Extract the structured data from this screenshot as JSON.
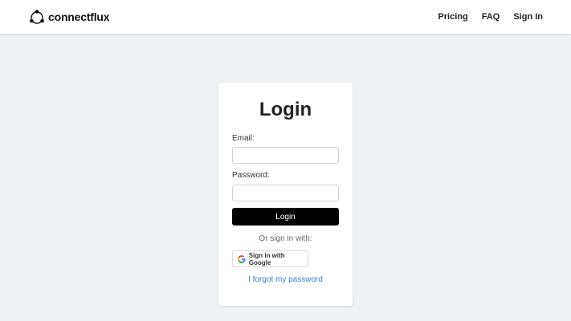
{
  "header": {
    "brand_name": "connectflux",
    "logo_icon": "network-nodes-icon",
    "nav": [
      {
        "label": "Pricing"
      },
      {
        "label": "FAQ"
      },
      {
        "label": "Sign In"
      }
    ]
  },
  "login": {
    "title": "Login",
    "email_label": "Email:",
    "email_value": "",
    "password_label": "Password:",
    "password_value": "",
    "submit_label": "Login",
    "alt_text": "Or sign in with:",
    "google_label": "Sign in with Google",
    "google_icon": "google-g-icon",
    "forgot_label": "I forgot my password"
  },
  "colors": {
    "background": "#f0f1f5",
    "button": "#000000",
    "link": "#3b7fc9"
  }
}
